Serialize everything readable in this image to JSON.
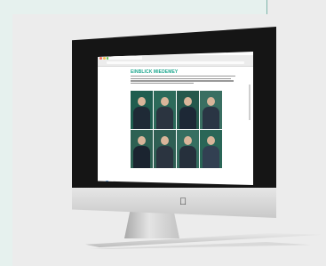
{
  "page": {
    "heading": "EINBLICK MIEDEMEY"
  },
  "browser": {
    "window_dots": [
      "#ef6a5c",
      "#f5c04f",
      "#62c554"
    ]
  },
  "colors": {
    "accent": "#1fa88f",
    "background": "#ececec",
    "mint": "#e6f1ee",
    "bezel": "#151515"
  },
  "icons": {
    "brand_logo": "apple-logo-icon",
    "chat_button": "chat-bubble-icon"
  },
  "gallery": {
    "tiles": [
      {
        "bg": "#1f5d4f",
        "shirt": "#1f2a36"
      },
      {
        "bg": "#2c6a5a",
        "shirt": "#2b3440"
      },
      {
        "bg": "#25584c",
        "shirt": "#1d2836"
      },
      {
        "bg": "#3a6f62",
        "shirt": "#2a3544"
      },
      {
        "bg": "#2d6153",
        "shirt": "#1b2430"
      },
      {
        "bg": "#2f5f54",
        "shirt": "#2b3440"
      },
      {
        "bg": "#356e60",
        "shirt": "#26303c"
      },
      {
        "bg": "#2a6657",
        "shirt": "#324052"
      }
    ]
  }
}
